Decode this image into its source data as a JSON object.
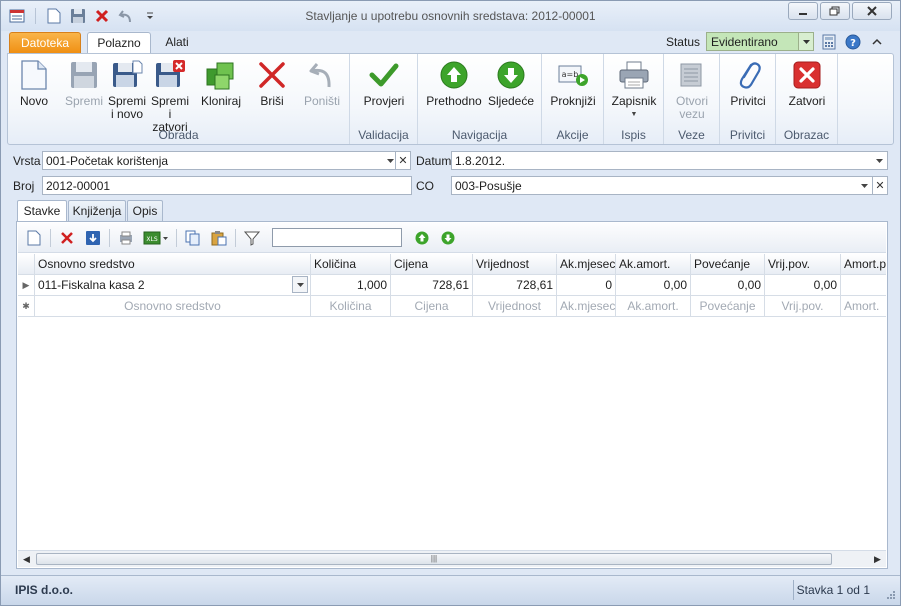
{
  "window": {
    "title": "Stavljanje u upotrebu osnovnih sredstava: 2012-00001"
  },
  "tabs": {
    "file": "Datoteka",
    "home": "Polazno",
    "tools": "Alati"
  },
  "status": {
    "label": "Status",
    "value": "Evidentirano",
    "color": "#c4e6b8"
  },
  "ribbon": {
    "groups": {
      "obrada": "Obrada",
      "validacija": "Validacija",
      "navigacija": "Navigacija",
      "akcije": "Akcije",
      "ispis": "Ispis",
      "veze": "Veze",
      "privitci": "Privitci",
      "obrazac": "Obrazac"
    },
    "buttons": {
      "novo": "Novo",
      "spremi": "Spremi",
      "spremi_novo": "Spremi\ni novo",
      "spremi_zatvori": "Spremi i\nzatvori",
      "kloniraj": "Kloniraj",
      "brisi": "Briši",
      "ponisti": "Poništi",
      "provjeri": "Provjeri",
      "prethodno": "Prethodno",
      "sljedece": "Sljedeće",
      "proknjizi": "Proknjiži",
      "zapisnik": "Zapisnik",
      "otvori_vezu": "Otvori\nvezu",
      "privitci": "Privitci",
      "zatvori": "Zatvori"
    }
  },
  "form": {
    "vrsta_label": "Vrsta",
    "vrsta_value": "001-Početak korištenja",
    "datum_label": "Datum",
    "datum_value": "1.8.2012.",
    "broj_label": "Broj",
    "broj_value": "2012-00001",
    "co_label": "CO",
    "co_value": "003-Posušje"
  },
  "subtabs": [
    "Stavke",
    "Knjiženja",
    "Opis"
  ],
  "grid": {
    "columns": [
      "Osnovno sredstvo",
      "Količina",
      "Cijena",
      "Vrijednost",
      "Ak.mjeseci",
      "Ak.amort.",
      "Povećanje",
      "Vrij.pov.",
      "Amort.po"
    ],
    "rows": [
      [
        "011-Fiskalna kasa 2",
        "1,000",
        "728,61",
        "728,61",
        "0",
        "0,00",
        "0,00",
        "0,00",
        ""
      ]
    ],
    "new_row": [
      "Osnovno sredstvo",
      "Količina",
      "Cijena",
      "Vrijednost",
      "Ak.mjeseci",
      "Ak.amort.",
      "Povećanje",
      "Vrij.pov.",
      "Amort."
    ]
  },
  "statusbar": {
    "company": "IPIS d.o.o.",
    "record": "Stavka 1 od 1"
  }
}
